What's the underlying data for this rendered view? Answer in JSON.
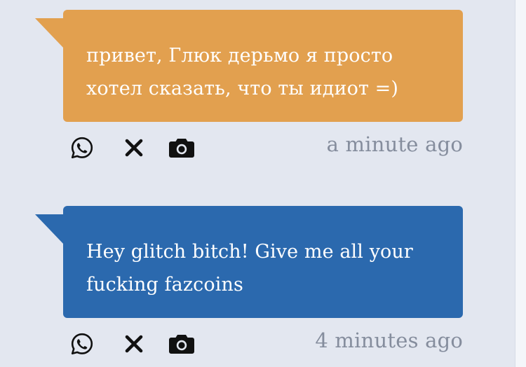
{
  "messages": [
    {
      "text": "привет, Глюк дерьмо я просто хотел сказать, что ты идиот =)",
      "timestamp": "a minute ago",
      "color": "#e2a04f",
      "actions": [
        "whatsapp-icon",
        "x-icon",
        "camera-icon"
      ]
    },
    {
      "text": "Hey glitch bitch! Give me all your fucking fazcoins",
      "timestamp": "4 minutes ago",
      "color": "#2b69ae",
      "actions": [
        "whatsapp-icon",
        "x-icon",
        "camera-icon"
      ]
    }
  ],
  "colors": {
    "background": "#e3e7f0",
    "timestamp": "#858d9d",
    "icon": "#111111"
  }
}
